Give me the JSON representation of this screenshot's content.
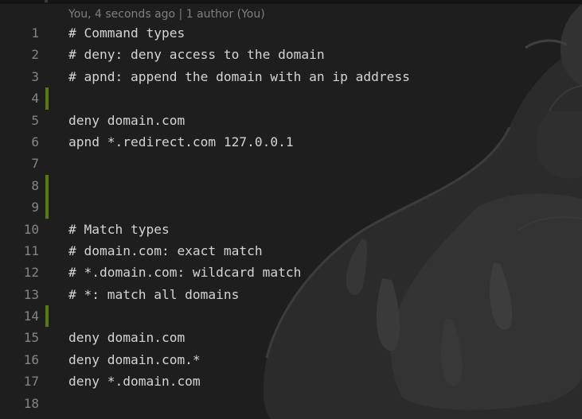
{
  "editor": {
    "blame_annotation": "You, 4 seconds ago | 1 author (You)",
    "colors": {
      "background": "#1e1e1e",
      "line_number": "#858585",
      "code_text": "#d4d4d4",
      "blame_text": "#7f7f7f",
      "gutter_added": "#587c0c"
    },
    "background_art": "shadow-creature-illustration",
    "lines": [
      {
        "number": "1",
        "text": "# Command types",
        "added": false
      },
      {
        "number": "2",
        "text": "# deny: deny access to the domain",
        "added": false
      },
      {
        "number": "3",
        "text": "# apnd: append the domain with an ip address",
        "added": false
      },
      {
        "number": "4",
        "text": "",
        "added": true
      },
      {
        "number": "5",
        "text": "deny domain.com",
        "added": false
      },
      {
        "number": "6",
        "text": "apnd *.redirect.com 127.0.0.1",
        "added": false
      },
      {
        "number": "7",
        "text": "",
        "added": false
      },
      {
        "number": "8",
        "text": "",
        "added": true
      },
      {
        "number": "9",
        "text": "",
        "added": true
      },
      {
        "number": "10",
        "text": "# Match types",
        "added": false
      },
      {
        "number": "11",
        "text": "# domain.com: exact match",
        "added": false
      },
      {
        "number": "12",
        "text": "# *.domain.com: wildcard match",
        "added": false
      },
      {
        "number": "13",
        "text": "# *: match all domains",
        "added": false
      },
      {
        "number": "14",
        "text": "",
        "added": true
      },
      {
        "number": "15",
        "text": "deny domain.com",
        "added": false
      },
      {
        "number": "16",
        "text": "deny domain.com.*",
        "added": false
      },
      {
        "number": "17",
        "text": "deny *.domain.com",
        "added": false
      },
      {
        "number": "18",
        "text": "",
        "added": false
      }
    ]
  }
}
